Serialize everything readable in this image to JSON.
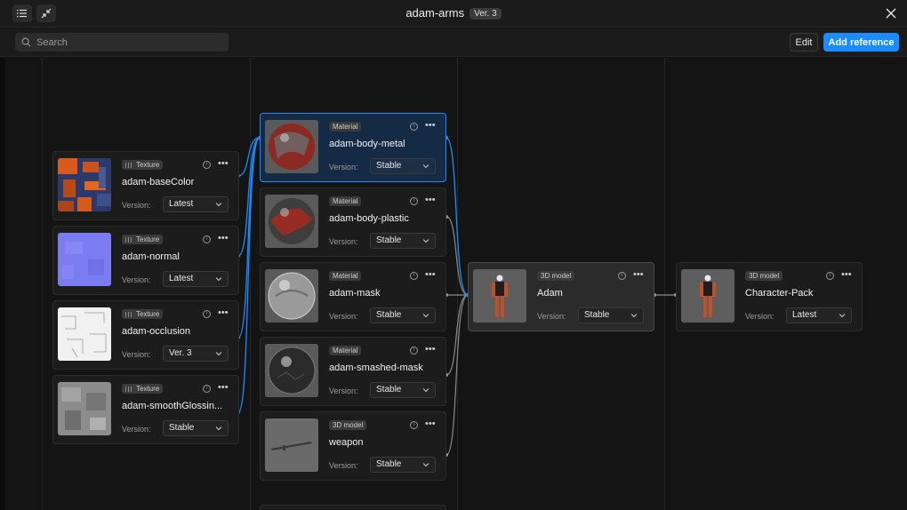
{
  "window": {
    "title": "adam-arms",
    "version_badge": "Ver. 3"
  },
  "toolbar": {
    "search_placeholder": "Search",
    "edit_label": "Edit",
    "add_label": "Add reference"
  },
  "version_label": "Version:",
  "nodes": {
    "tex1": {
      "kind": "Texture",
      "name": "adam-baseColor",
      "version": "Latest"
    },
    "tex2": {
      "kind": "Texture",
      "name": "adam-normal",
      "version": "Latest"
    },
    "tex3": {
      "kind": "Texture",
      "name": "adam-occlusion",
      "version": "Ver. 3"
    },
    "tex4": {
      "kind": "Texture",
      "name": "adam-smoothGlossin...",
      "version": "Stable"
    },
    "mat1": {
      "kind": "Material",
      "name": "adam-body-metal",
      "version": "Stable"
    },
    "mat2": {
      "kind": "Material",
      "name": "adam-body-plastic",
      "version": "Stable"
    },
    "mat3": {
      "kind": "Material",
      "name": "adam-mask",
      "version": "Stable"
    },
    "mat4": {
      "kind": "Material",
      "name": "adam-smashed-mask",
      "version": "Stable"
    },
    "mdl1": {
      "kind": "3D model",
      "name": "weapon",
      "version": "Stable"
    },
    "center": {
      "kind": "3D model",
      "name": "Adam",
      "version": "Stable"
    },
    "pack": {
      "kind": "3D model",
      "name": "Character-Pack",
      "version": "Latest"
    }
  },
  "colors": {
    "accent": "#1a8cff",
    "selected_bg": "#152a44",
    "wire": "#8a8a8a"
  },
  "icons": [
    "list-icon",
    "collapse-icon",
    "close-icon",
    "search-icon",
    "info-icon",
    "more-icon",
    "chevron-down-icon"
  ]
}
